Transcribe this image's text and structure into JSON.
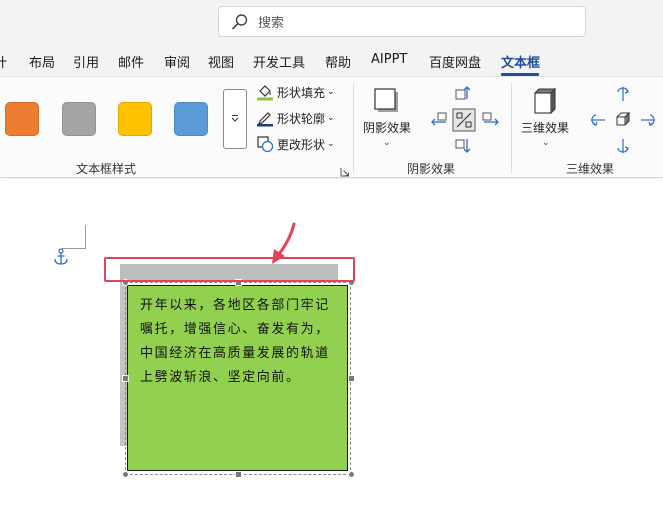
{
  "search": {
    "placeholder": "搜索"
  },
  "tabs": [
    {
      "label": "计",
      "active": false
    },
    {
      "label": "布局",
      "active": false
    },
    {
      "label": "引用",
      "active": false
    },
    {
      "label": "邮件",
      "active": false
    },
    {
      "label": "审阅",
      "active": false
    },
    {
      "label": "视图",
      "active": false
    },
    {
      "label": "开发工具",
      "active": false
    },
    {
      "label": "帮助",
      "active": false
    },
    {
      "label": "AIPPT",
      "active": false
    },
    {
      "label": "百度网盘",
      "active": false
    },
    {
      "label": "文本框",
      "active": true
    }
  ],
  "ribbon": {
    "textbox_styles": {
      "label": "文本框样式",
      "swatches": [
        "#ed7d31",
        "#a5a5a5",
        "#ffc000",
        "#5b9bd5"
      ],
      "shape_fill": "形状填充",
      "shape_outline": "形状轮廓",
      "change_shape": "更改形状"
    },
    "shadow_effects": {
      "label": "阴影效果",
      "button": "阴影效果"
    },
    "three_d_effects": {
      "label": "三维效果",
      "button": "三维效果"
    }
  },
  "document": {
    "textbox_text": "开年以来，各地区各部门牢记嘱托，增强信心、奋发有为，中国经济在高质量发展的轨道上劈波斩浪、坚定向前。",
    "textbox_fill": "#92d050",
    "highlight_color": "#e2435a"
  }
}
